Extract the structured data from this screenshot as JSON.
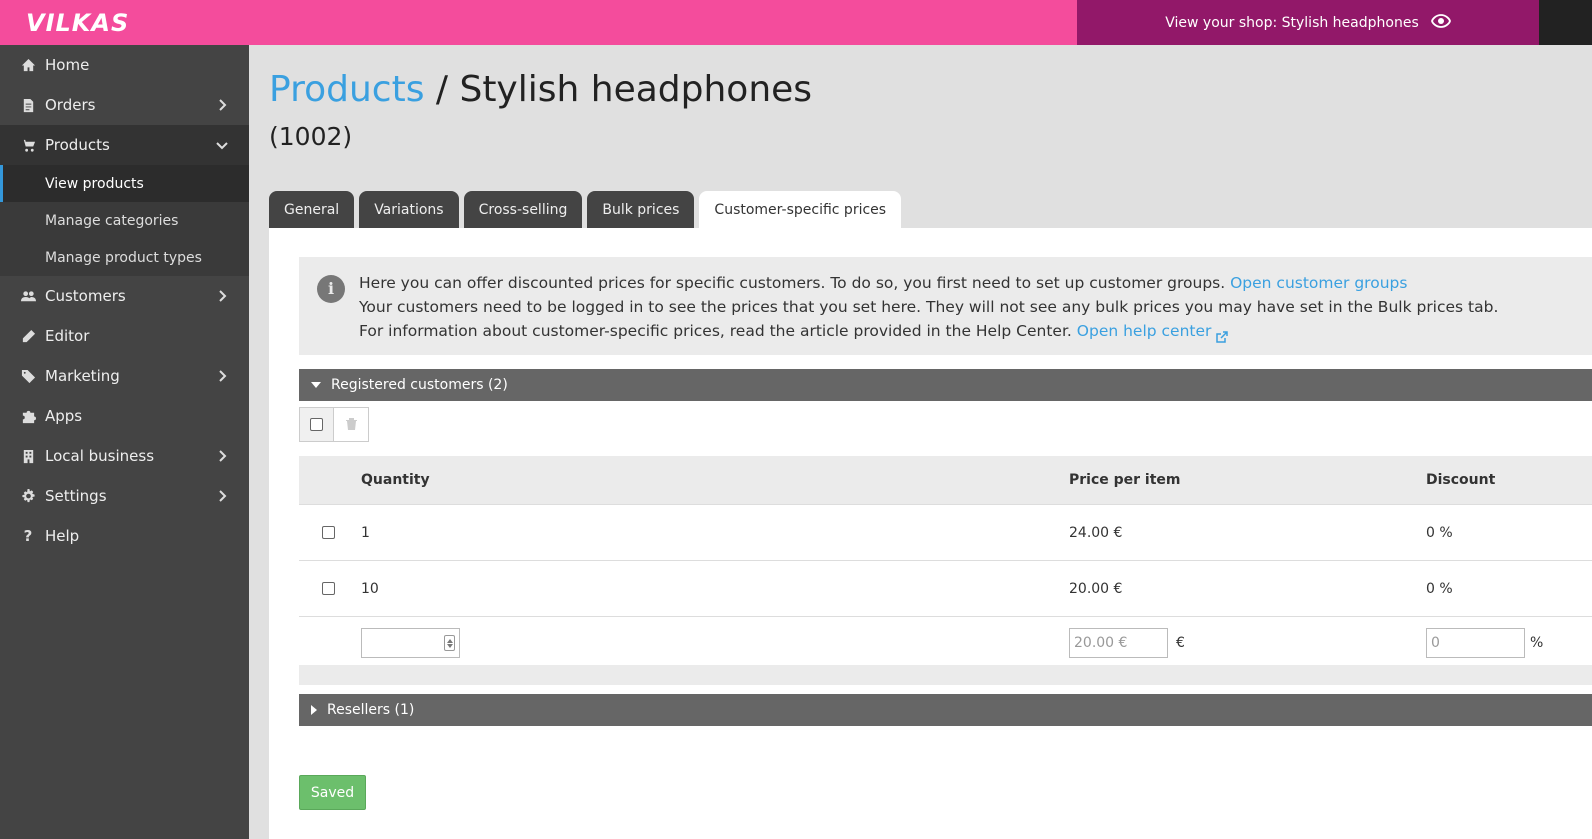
{
  "header": {
    "logo": "VILKAS",
    "shop_link": "View your shop: Stylish headphones",
    "shop_icon": "eye-icon",
    "brand_color": "#f44c9c",
    "shop_bg_color": "#921869"
  },
  "sidebar": {
    "items": [
      {
        "label": "Home",
        "icon": "home-icon"
      },
      {
        "label": "Orders",
        "icon": "orders-icon"
      },
      {
        "label": "Products",
        "icon": "cart-icon"
      },
      {
        "label": "Customers",
        "icon": "users-icon"
      },
      {
        "label": "Editor",
        "icon": "pencil-icon"
      },
      {
        "label": "Marketing",
        "icon": "tag-icon"
      },
      {
        "label": "Apps",
        "icon": "puzzle-icon"
      },
      {
        "label": "Local business",
        "icon": "building-icon"
      },
      {
        "label": "Settings",
        "icon": "gear-icon"
      },
      {
        "label": "Help",
        "icon": "question-icon"
      }
    ],
    "products_sub": [
      {
        "label": "View products"
      },
      {
        "label": "Manage categories"
      },
      {
        "label": "Manage product types"
      }
    ]
  },
  "page": {
    "breadcrumb": "Products",
    "separator": " / ",
    "title": "Stylish headphones",
    "product_id": "(1002)"
  },
  "tabs": [
    {
      "label": "General"
    },
    {
      "label": "Variations"
    },
    {
      "label": "Cross-selling"
    },
    {
      "label": "Bulk prices"
    },
    {
      "label": "Customer-specific prices"
    }
  ],
  "info": {
    "line1": "Here you can offer discounted prices for specific customers. To do so, you first need to set up customer groups. ",
    "line1_link": "Open customer groups",
    "line2": "Your customers need to be logged in to see the prices that you set here. They will not see any bulk prices you may have set in the Bulk prices tab.",
    "line3": "For information about customer-specific prices, read the article provided in the Help Center. ",
    "line3_link": "Open help center"
  },
  "groups": {
    "registered": "Registered customers (2)",
    "resellers": "Resellers (1)"
  },
  "table": {
    "headers": {
      "quantity": "Quantity",
      "price": "Price per item",
      "discount": "Discount"
    },
    "rows": [
      {
        "quantity": "1",
        "price": "24.00 €",
        "discount": "0 %"
      },
      {
        "quantity": "10",
        "price": "20.00 €",
        "discount": "0 %"
      }
    ],
    "new_row": {
      "quantity_value": "",
      "price_placeholder": "20.00 €",
      "price_unit": "€",
      "discount_placeholder": "0",
      "discount_unit": "%"
    }
  },
  "save_button": "Saved"
}
